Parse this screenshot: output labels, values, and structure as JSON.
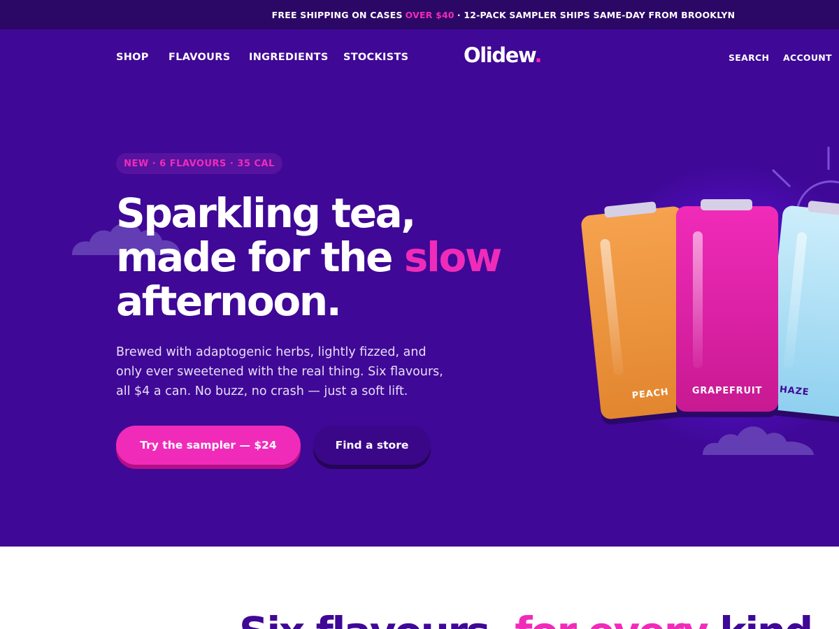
{
  "announcement": {
    "prefix": "FREE SHIPPING ON CASES",
    "highlight": "OVER $40",
    "suffix": "· 12-PACK SAMPLER SHIPS SAME-DAY FROM BROOKLYN"
  },
  "nav": {
    "links": [
      {
        "label": "SHOP"
      },
      {
        "label": "FLAVOURS"
      },
      {
        "label": "INGREDIENTS"
      },
      {
        "label": "STOCKISTS"
      }
    ],
    "logo": "Olidew",
    "logo_dot": ".",
    "utility": [
      {
        "label": "SEARCH"
      },
      {
        "label": "ACCOUNT"
      }
    ]
  },
  "hero": {
    "badge": "NEW · 6 FLAVOURS · 35 CAL",
    "headline": {
      "line1": "Sparkling tea,",
      "line2_prefix": "made for the ",
      "line2_highlight": "slow",
      "line3": "afternoon."
    },
    "body": "Brewed with adaptogenic herbs, lightly fizzed, and only ever sweetened with the real thing. Six flavours, all $4 a can. No buzz, no crash — just a soft lift.",
    "primary_cta": "Try the sampler — $24",
    "secondary_cta": "Find a store",
    "cans": [
      {
        "label": "PEACH"
      },
      {
        "label": "GRAPEFRUIT"
      },
      {
        "label": "HAZE"
      }
    ]
  },
  "section2": {
    "title_prefix": "Six flavours, ",
    "title_highlight": "for every",
    "title_suffix": " kind"
  },
  "colors": {
    "brand_purple": "#3f0896",
    "dark_purple": "#2b0766",
    "accent_pink": "#f02bb9",
    "peach": "#f6a24e",
    "haze": "#9fd8f3"
  }
}
